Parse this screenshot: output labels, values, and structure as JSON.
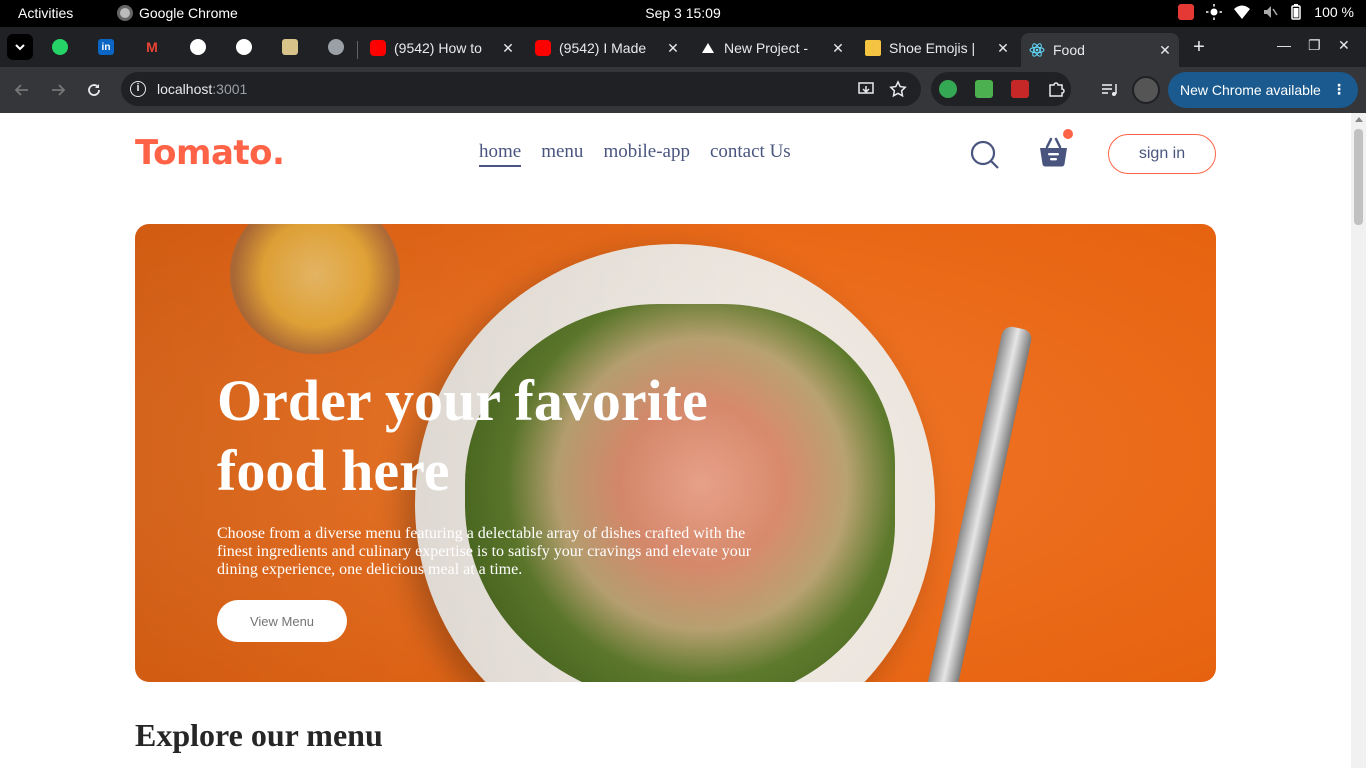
{
  "system_bar": {
    "activities": "Activities",
    "app_name": "Google Chrome",
    "clock": "Sep 3  15:09",
    "battery": "100 %"
  },
  "tabs": [
    {
      "title": "(9542) How to",
      "favicon": "youtube-icon"
    },
    {
      "title": "(9542) I Made",
      "favicon": "youtube-icon"
    },
    {
      "title": "New Project -",
      "favicon": "vercel-icon"
    },
    {
      "title": "Shoe Emojis |",
      "favicon": "folder-icon"
    },
    {
      "title": "Food",
      "favicon": "react-icon",
      "active": true
    }
  ],
  "pinned_tabs": [
    "whatsapp-icon",
    "linkedin-icon",
    "gmail-icon",
    "github-icon",
    "github-icon",
    "image-icon",
    "copilot-icon"
  ],
  "toolbar": {
    "url_host": "localhost",
    "url_port": ":3001",
    "update_label": "New Chrome available"
  },
  "site": {
    "logo": "Tomato.",
    "nav": [
      "home",
      "menu",
      "mobile-app",
      "contact Us"
    ],
    "signin_label": "sign in",
    "hero_title": "Order your favorite food here",
    "hero_text": "Choose from a diverse menu featuring a delectable array of dishes crafted with the finest ingredients and culinary expertise is to satisfy your cravings and elevate your dining experience, one delicious meal at a time.",
    "hero_button": "View Menu",
    "explore_heading": "Explore our menu"
  },
  "colors": {
    "brand": "#ff6347",
    "nav_text": "#49557e",
    "hero_bg": "#ec6e1e"
  }
}
